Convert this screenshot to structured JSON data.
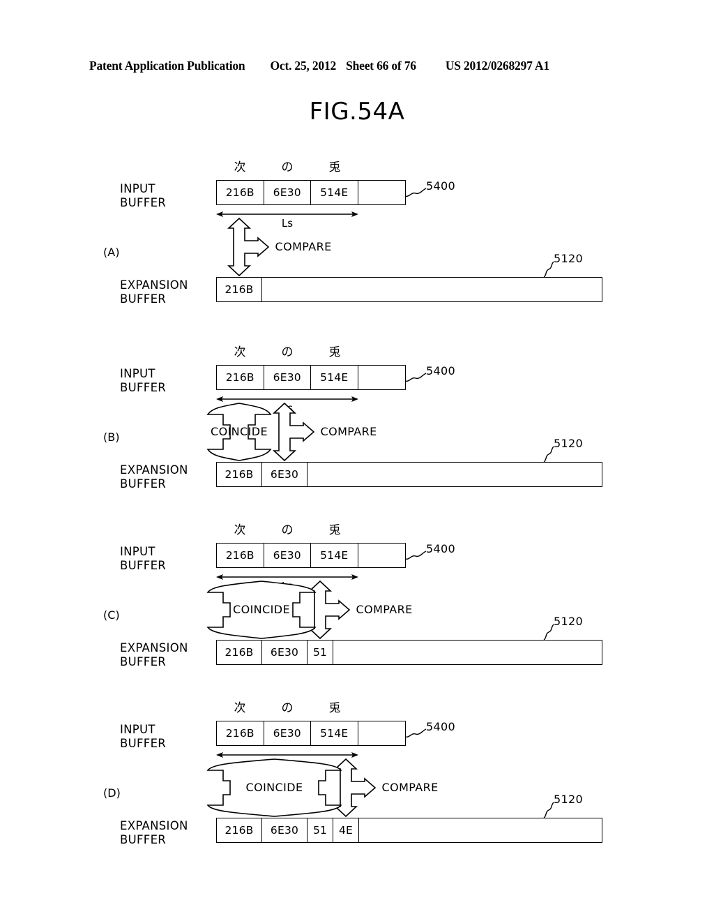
{
  "header": {
    "publication": "Patent Application Publication",
    "date": "Oct. 25, 2012",
    "sheet": "Sheet 66 of 76",
    "pub_number": "US 2012/0268297 A1"
  },
  "figure": {
    "title": "FIG.54A"
  },
  "labels": {
    "input_buffer": "INPUT\nBUFFER",
    "input_buffer_line1": "INPUT",
    "input_buffer_line2": "BUFFER",
    "expansion_buffer_line1": "EXPANSION",
    "expansion_buffer_line2": "BUFFER",
    "ls": "Ls",
    "compare": "COMPARE",
    "coincide": "COINCIDE",
    "ref_input_buffer": "5400",
    "ref_expansion_buffer": "5120"
  },
  "japanese_chars": [
    "次",
    "の",
    "兎"
  ],
  "panels": [
    {
      "id": "A",
      "label": "(A)",
      "input_cells": [
        "216B",
        "6E30",
        "514E",
        ""
      ],
      "expansion_cells": [
        "216B"
      ],
      "has_coincide": false,
      "coincide_span": 0,
      "compare_target_index": 0
    },
    {
      "id": "B",
      "label": "(B)",
      "input_cells": [
        "216B",
        "6E30",
        "514E",
        ""
      ],
      "expansion_cells": [
        "216B",
        "6E30"
      ],
      "has_coincide": true,
      "coincide_span": 1,
      "compare_target_index": 1
    },
    {
      "id": "C",
      "label": "(C)",
      "input_cells": [
        "216B",
        "6E30",
        "514E",
        ""
      ],
      "expansion_cells": [
        "216B",
        "6E30",
        "51"
      ],
      "has_coincide": true,
      "coincide_span": 2,
      "compare_target_index": 2
    },
    {
      "id": "D",
      "label": "(D)",
      "input_cells": [
        "216B",
        "6E30",
        "514E",
        ""
      ],
      "expansion_cells": [
        "216B",
        "6E30",
        "51",
        "4E"
      ],
      "has_coincide": true,
      "coincide_span": 3,
      "compare_target_index": 3
    }
  ],
  "colors": {
    "ink": "#000000",
    "paper": "#ffffff"
  }
}
